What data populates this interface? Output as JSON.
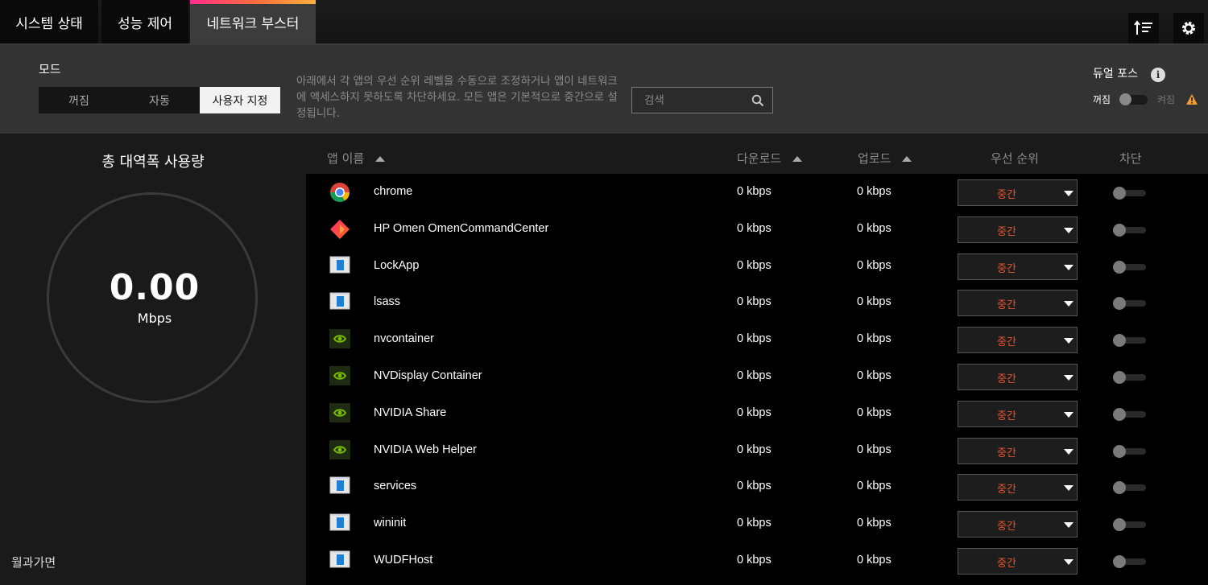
{
  "tabs": [
    {
      "label": "시스템 상태"
    },
    {
      "label": "성능 제어"
    },
    {
      "label": "네트워크 부스터"
    }
  ],
  "header_icons": {
    "sort": "sort-icon",
    "settings": "gear-icon"
  },
  "mode": {
    "label": "모드",
    "options": [
      "꺼짐",
      "자동",
      "사용자 지정"
    ],
    "selected": "사용자 지정",
    "description": "아래에서 각 앱의 우선 순위 레벨을 수동으로 조정하거나 앱이 네트워크에 액세스하지 못하도록 차단하세요. 모든 앱은 기본적으로 중간으로 설정됩니다."
  },
  "search": {
    "placeholder": "검색"
  },
  "dual_force": {
    "label": "듀얼 포스",
    "off_label": "꺼짐",
    "on_label": "켜짐",
    "enabled": false
  },
  "bandwidth": {
    "title": "총 대역폭 사용량",
    "value": "0.00",
    "unit": "Mbps"
  },
  "watermark": "월과가면",
  "table": {
    "columns": {
      "name": "앱 이름",
      "download": "다운로드",
      "upload": "업로드",
      "priority": "우선 순위",
      "block": "차단"
    },
    "rows": [
      {
        "name": "chrome",
        "icon": "chrome-icon",
        "download": "0 kbps",
        "upload": "0 kbps",
        "priority": "중간",
        "blocked": false
      },
      {
        "name": "HP Omen OmenCommandCenter",
        "icon": "omen-icon",
        "download": "0 kbps",
        "upload": "0 kbps",
        "priority": "중간",
        "blocked": false
      },
      {
        "name": "LockApp",
        "icon": "window-icon",
        "download": "0 kbps",
        "upload": "0 kbps",
        "priority": "중간",
        "blocked": false
      },
      {
        "name": "lsass",
        "icon": "window-icon",
        "download": "0 kbps",
        "upload": "0 kbps",
        "priority": "중간",
        "blocked": false
      },
      {
        "name": "nvcontainer",
        "icon": "nvidia-icon",
        "download": "0 kbps",
        "upload": "0 kbps",
        "priority": "중간",
        "blocked": false
      },
      {
        "name": "NVDisplay Container",
        "icon": "nvidia-icon",
        "download": "0 kbps",
        "upload": "0 kbps",
        "priority": "중간",
        "blocked": false
      },
      {
        "name": "NVIDIA Share",
        "icon": "nvidia-icon",
        "download": "0 kbps",
        "upload": "0 kbps",
        "priority": "중간",
        "blocked": false
      },
      {
        "name": "NVIDIA Web Helper",
        "icon": "nvidia-icon",
        "download": "0 kbps",
        "upload": "0 kbps",
        "priority": "중간",
        "blocked": false
      },
      {
        "name": "services",
        "icon": "window-icon",
        "download": "0 kbps",
        "upload": "0 kbps",
        "priority": "중간",
        "blocked": false
      },
      {
        "name": "wininit",
        "icon": "window-icon",
        "download": "0 kbps",
        "upload": "0 kbps",
        "priority": "중간",
        "blocked": false
      },
      {
        "name": "WUDFHost",
        "icon": "window-icon",
        "download": "0 kbps",
        "upload": "0 kbps",
        "priority": "중간",
        "blocked": false
      }
    ]
  },
  "colors": {
    "accent_gradient_start": "#ff2d8c",
    "accent_gradient_end": "#ffb13b",
    "priority_text": "#e8542e",
    "warning": "#f0a030"
  }
}
